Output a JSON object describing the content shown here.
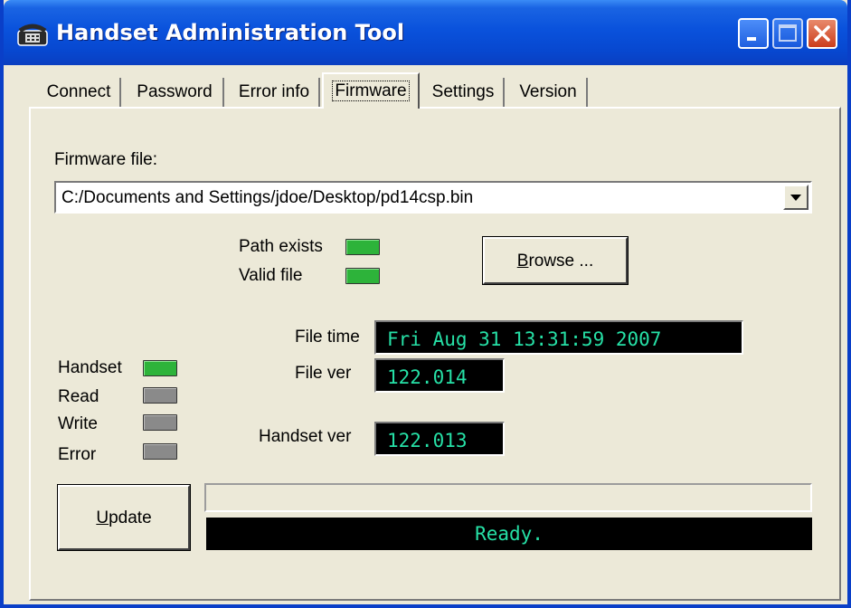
{
  "window": {
    "title": "Handset Administration Tool",
    "icon": "phone-icon"
  },
  "tabs": [
    {
      "label": "Connect",
      "active": false
    },
    {
      "label": "Password",
      "active": false
    },
    {
      "label": "Error info",
      "active": false
    },
    {
      "label": "Firmware",
      "active": true
    },
    {
      "label": "Settings",
      "active": false
    },
    {
      "label": "Version",
      "active": false
    }
  ],
  "firmware": {
    "file_label": "Firmware file:",
    "file_value": "C:/Documents and Settings/jdoe/Desktop/pd14csp.bin",
    "path_exists_label": "Path exists",
    "path_exists": true,
    "valid_file_label": "Valid file",
    "valid_file": true,
    "browse_underlined": "B",
    "browse_rest": "rowse ...",
    "file_time_label": "File time",
    "file_time_value": "Fri Aug 31 13:31:59 2007",
    "file_ver_label": "File ver",
    "file_ver_value": "122.014",
    "handset_ver_label": "Handset ver",
    "handset_ver_value": "122.013"
  },
  "indicators": [
    {
      "label": "Handset",
      "state": "on"
    },
    {
      "label": "Read",
      "state": "off"
    },
    {
      "label": "Write",
      "state": "off"
    },
    {
      "label": "Error",
      "state": "off"
    }
  ],
  "update": {
    "underlined": "U",
    "rest": "pdate"
  },
  "progress": 0,
  "status_text": "Ready.",
  "colors": {
    "title_bar": "#0a52dc",
    "led_on": "#2db33a",
    "led_off": "#8a8a8a",
    "lcd_text": "#26e0a6",
    "face": "#ece9d8"
  }
}
